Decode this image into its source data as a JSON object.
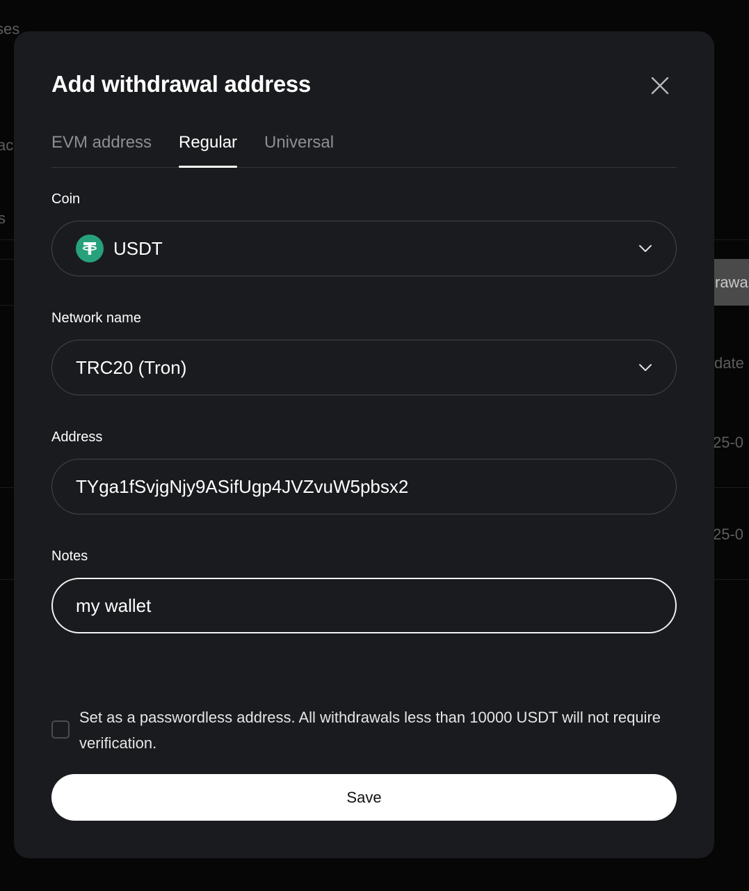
{
  "background": {
    "fragments": [
      "ses",
      "ac",
      "s",
      "rawa",
      "date",
      "25-0",
      "25-0"
    ]
  },
  "modal": {
    "title": "Add withdrawal address",
    "tabs": [
      {
        "label": "EVM address",
        "active": false
      },
      {
        "label": "Regular",
        "active": true
      },
      {
        "label": "Universal",
        "active": false
      }
    ],
    "coin": {
      "label": "Coin",
      "value": "USDT",
      "icon": "tether-icon",
      "icon_color": "#26a17b"
    },
    "network": {
      "label": "Network name",
      "value": "TRC20 (Tron)"
    },
    "address": {
      "label": "Address",
      "value": "TYga1fSvjgNjy9ASifUgp4JVZvuW5pbsx2"
    },
    "notes": {
      "label": "Notes",
      "value": "my wallet"
    },
    "passwordless": {
      "checked": false,
      "label": "Set as a passwordless address. All withdrawals less than 10000 USDT will not require verification."
    },
    "save_label": "Save"
  },
  "colors": {
    "modal_bg": "#1a1b1e",
    "accent": "#ffffff",
    "muted_text": "#8d8f94",
    "usdt_green": "#26a17b"
  }
}
